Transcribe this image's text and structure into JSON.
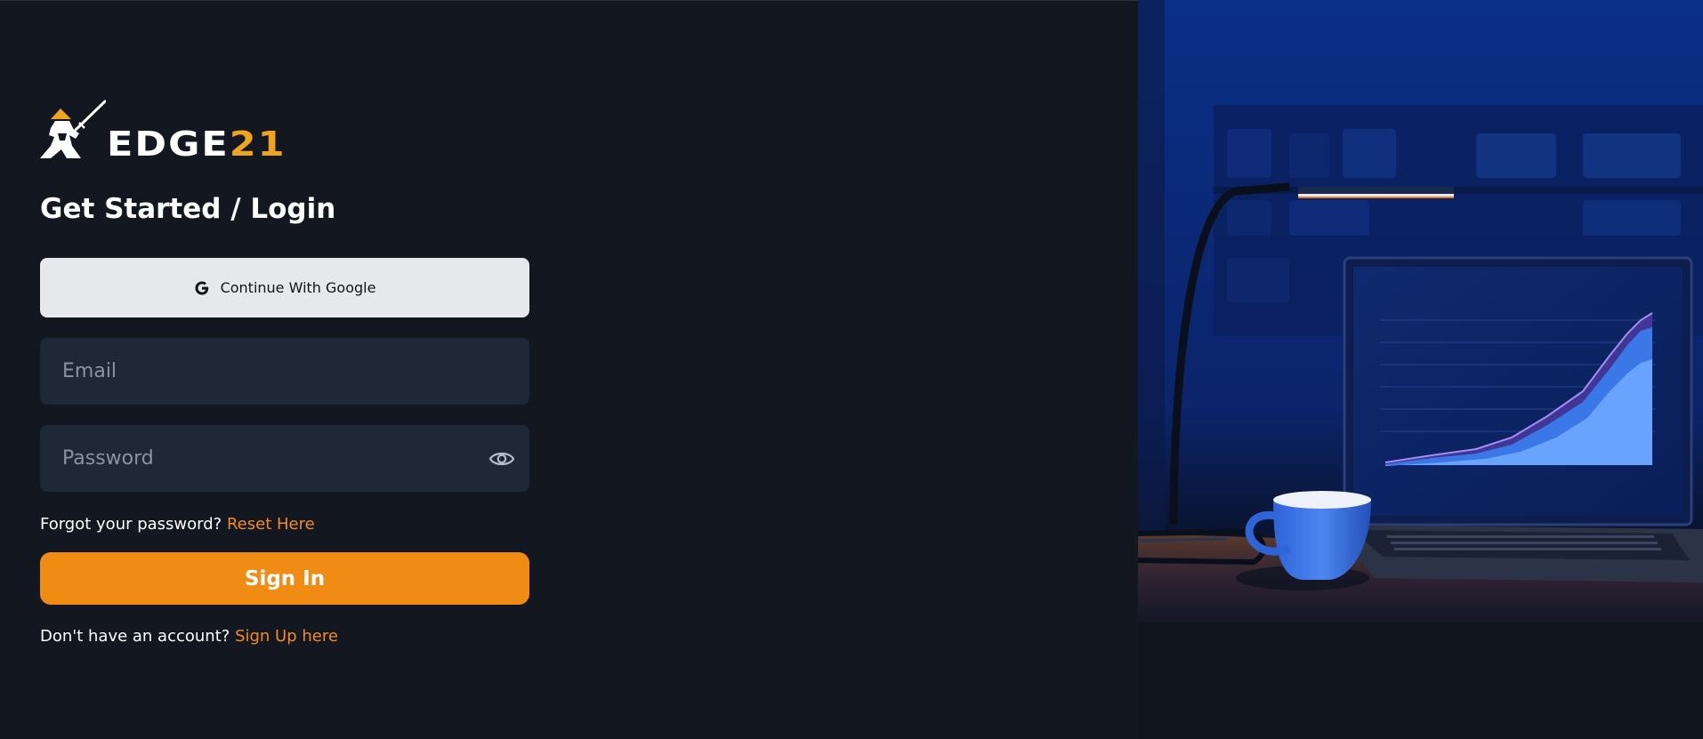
{
  "brand": {
    "name_part1": "EDGE",
    "name_part2": "21",
    "accent_color": "#f0a31c"
  },
  "login": {
    "title": "Get Started / Login",
    "google_button": {
      "label": "Continue With Google",
      "icon": "google-icon"
    },
    "email": {
      "placeholder": "Email",
      "value": ""
    },
    "password": {
      "placeholder": "Password",
      "value": "",
      "toggle_icon": "eye-icon"
    },
    "forgot": {
      "text": "Forgot your password?",
      "link": "Reset Here"
    },
    "signin_label": "Sign In",
    "signup": {
      "text": "Don't have an account?",
      "link": "Sign Up here"
    }
  },
  "colors": {
    "background": "#131720",
    "field_background": "#1f2837",
    "primary_button": "#f08c14",
    "link": "#f38a24",
    "google_button": "#e6e8ec"
  },
  "hero_image": {
    "subject": "laptop with rising chart, blue coffee cup, desk lamp"
  }
}
